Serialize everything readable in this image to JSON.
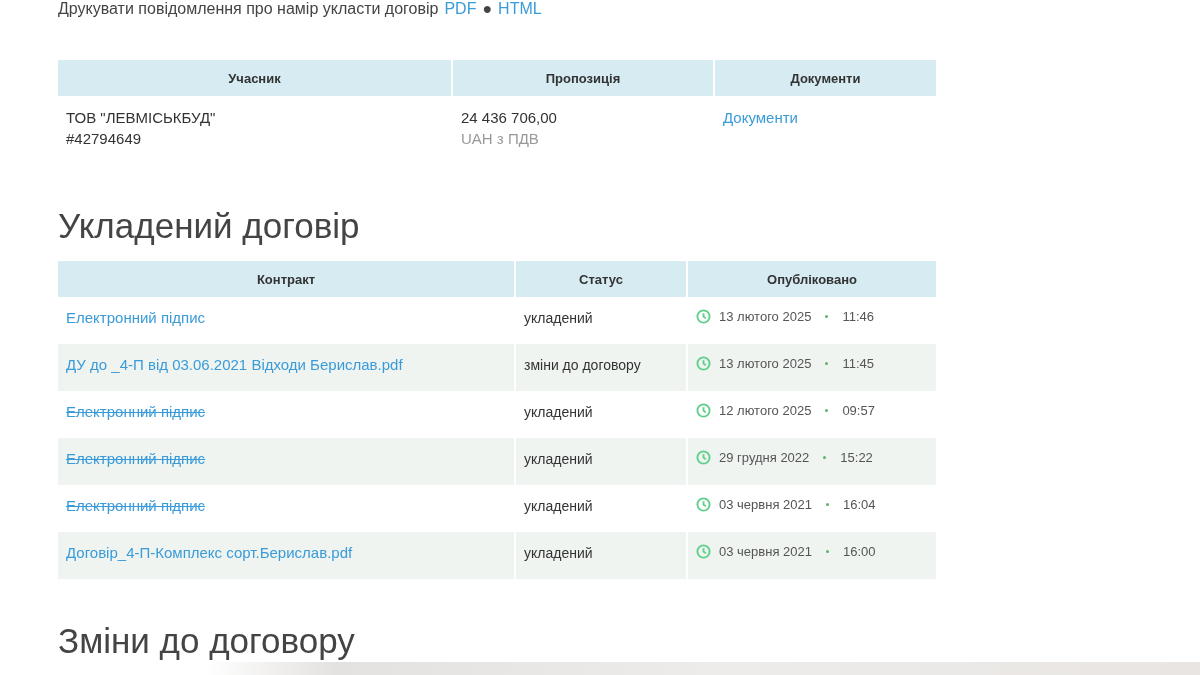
{
  "print_line": {
    "text": "Друкувати повідомлення про намір укласти договір",
    "links": [
      "PDF",
      "HTML"
    ],
    "separator": "●"
  },
  "participants": {
    "columns": [
      "Учасник",
      "Пропозиція",
      "Документи"
    ],
    "rows": [
      {
        "name": "ТОВ \"ЛЕВМІСЬКБУД\"",
        "code": "#42794649",
        "amount": "24 436 706,00",
        "currency": "UAH з ПДВ",
        "documents": "Документи"
      }
    ]
  },
  "contract": {
    "title": "Укладений договір",
    "columns": [
      "Контракт",
      "Статус",
      "Опубліковано"
    ],
    "rows": [
      {
        "name": "Електронний підпис",
        "cancelled": false,
        "status": "укладений",
        "date": "13 лютого 2025",
        "time": "11:46"
      },
      {
        "name": "ДУ до _4-П від 03.06.2021 Відходи Берислав.pdf",
        "cancelled": false,
        "status": "зміни до договору",
        "date": "13 лютого 2025",
        "time": "11:45"
      },
      {
        "name": "Електронний підпис",
        "cancelled": true,
        "status": "укладений",
        "date": "12 лютого 2025",
        "time": "09:57"
      },
      {
        "name": "Електронний підпис",
        "cancelled": true,
        "status": "укладений",
        "date": "29 грудня 2022",
        "time": "15:22"
      },
      {
        "name": "Електронний підпис",
        "cancelled": true,
        "status": "укладений",
        "date": "03 червня 2021",
        "time": "16:04"
      },
      {
        "name": "Договір_4-П-Комплекс сорт.Берислав.pdf",
        "cancelled": false,
        "status": "укладений",
        "date": "03 червня 2021",
        "time": "16:00"
      }
    ]
  },
  "changes": {
    "title": "Зміни до договору"
  }
}
